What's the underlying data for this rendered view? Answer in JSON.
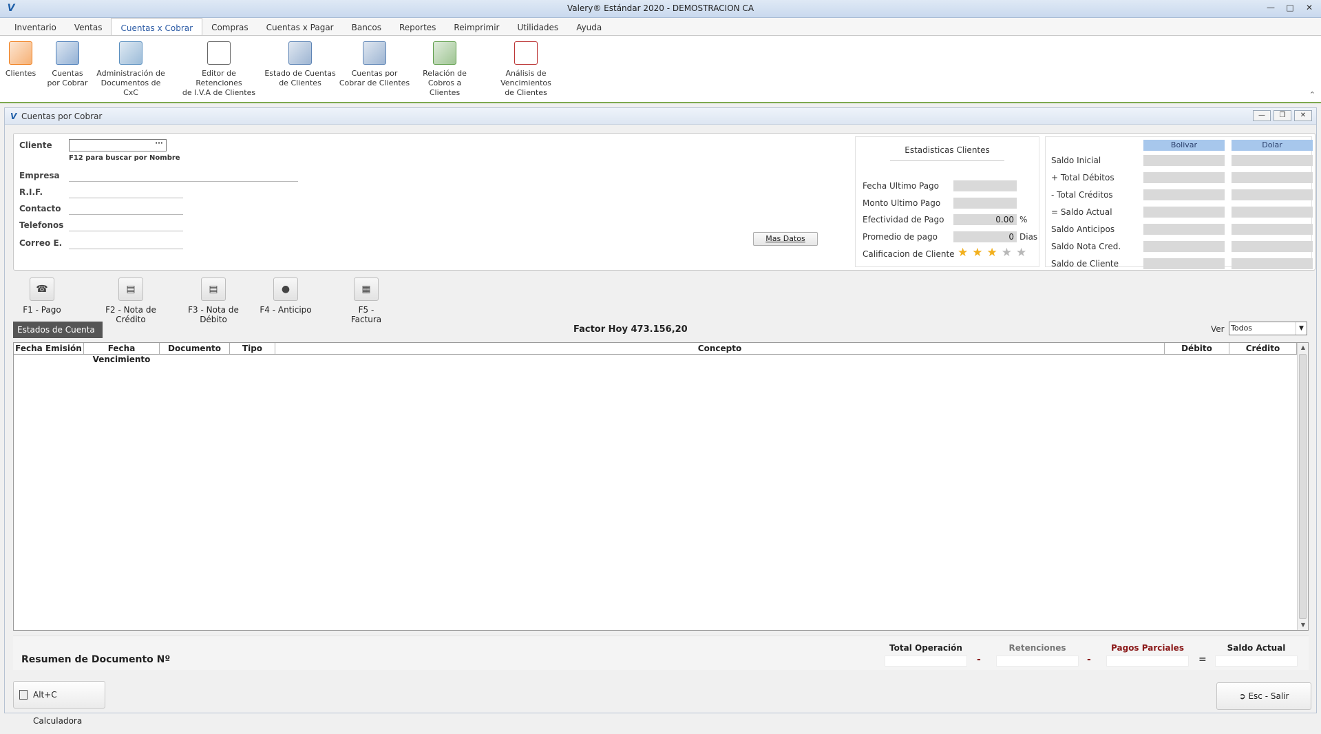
{
  "window": {
    "title": "Valery® Estándar 2020 - DEMOSTRACION CA"
  },
  "menu": [
    "Inventario",
    "Ventas",
    "Cuentas x Cobrar",
    "Compras",
    "Cuentas x Pagar",
    "Bancos",
    "Reportes",
    "Reimprimir",
    "Utilidades",
    "Ayuda"
  ],
  "menu_active": "Cuentas x Cobrar",
  "ribbon": [
    {
      "line1": "Clientes",
      "line2": "",
      "icon": "person-icon"
    },
    {
      "line1": "Cuentas",
      "line2": "por Cobrar",
      "icon": "cxc-document-icon"
    },
    {
      "line1": "Administración de",
      "line2": "Documentos de CxC",
      "icon": "documents-admin-icon"
    },
    {
      "line1": "Editor de Retenciones",
      "line2": "de I.V.A de Clientes",
      "icon": "tax-editor-icon"
    },
    {
      "line1": "Estado de Cuentas",
      "line2": "de Clientes",
      "icon": "account-statement-icon"
    },
    {
      "line1": "Cuentas por",
      "line2": "Cobrar de Clientes",
      "icon": "client-receivables-icon"
    },
    {
      "line1": "Relación de",
      "line2": "Cobros a Clientes",
      "icon": "collections-calendar-icon"
    },
    {
      "line1": "Análisis de Vencimientos",
      "line2": "de Clientes",
      "icon": "due-dates-calendar-icon"
    }
  ],
  "child_window": {
    "title": "Cuentas por Cobrar"
  },
  "client_form": {
    "cliente_label": "Cliente",
    "lookup_button": "···",
    "f12_hint": "F12 para buscar por Nombre",
    "empresa_label": "Empresa",
    "rif_label": "R.I.F.",
    "contacto_label": "Contacto",
    "telefonos_label": "Telefonos",
    "correo_label": "Correo E.",
    "mas_datos": "Mas Datos"
  },
  "stats": {
    "title": "Estadisticas Clientes",
    "fecha_ultimo_pago": "Fecha Ultimo Pago",
    "monto_ultimo_pago": "Monto Ultimo Pago",
    "efectividad_label": "Efectividad de Pago",
    "efectividad_value": "0.00",
    "efectividad_unit": "%",
    "promedio_label": "Promedio de pago",
    "promedio_value": "0",
    "promedio_unit": "Dias",
    "calificacion_label": "Calificacion de Cliente",
    "rating": 3,
    "rating_max": 5
  },
  "balances": {
    "col_bolivar": "Bolivar",
    "col_dolar": "Dolar",
    "rows": [
      "Saldo Inicial",
      "+ Total Débitos",
      "-  Total Créditos",
      "= Saldo Actual",
      "Saldo Anticipos",
      "Saldo Nota Cred.",
      "Saldo de Cliente"
    ]
  },
  "actions": [
    {
      "label": "F1 - Pago",
      "icon": "payment-icon"
    },
    {
      "label": "F2 - Nota de Crédito",
      "icon": "credit-note-icon"
    },
    {
      "label": "F3 - Nota de Débito",
      "icon": "debit-note-icon"
    },
    {
      "label": "F4 - Anticipo",
      "icon": "advance-icon"
    },
    {
      "label": "F5 - Factura",
      "icon": "invoice-icon"
    }
  ],
  "statement": {
    "tab": "Estados de Cuenta",
    "factor": "Factor Hoy  473.156,20",
    "ver_label": "Ver",
    "ver_value": "Todos",
    "columns": [
      "Fecha Emisión",
      "Fecha Vencimiento",
      "Documento",
      "Tipo",
      "Concepto",
      "Débito",
      "Crédito"
    ]
  },
  "summary": {
    "title": "Resumen de Documento Nº",
    "total_operacion": "Total Operación",
    "retenciones": "Retenciones",
    "pagos_parciales": "Pagos Parciales",
    "saldo_actual": "Saldo Actual",
    "op_minus": "-",
    "op_equals": "="
  },
  "footer": {
    "calculadora": "Alt+C Calculadora",
    "salir": "Esc - Salir"
  },
  "colors": {
    "accent": "#2a5aa5",
    "header_blue": "#a7c7ec",
    "ribbon_border": "#7da84f",
    "pagos_red": "#8b1a1a",
    "star": "#f2b01e"
  }
}
